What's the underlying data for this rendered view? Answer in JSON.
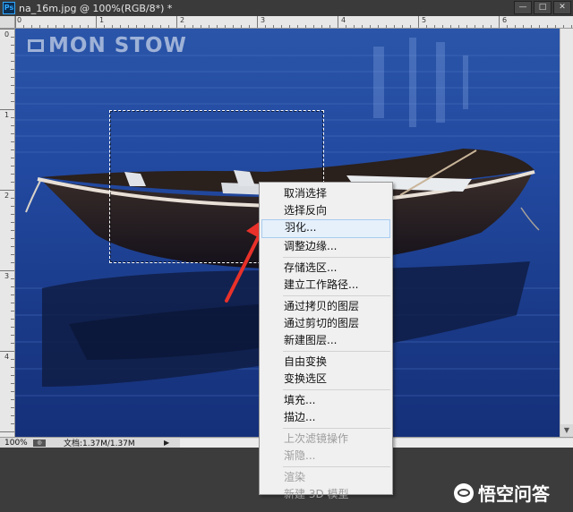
{
  "window": {
    "app_icon": "Ps",
    "title": "na_16m.jpg @ 100%(RGB/8*) *",
    "controls": {
      "minimize": "—",
      "maximize": "□",
      "close": "✕"
    }
  },
  "rulers": {
    "top": [
      "0",
      "1",
      "2",
      "3",
      "4",
      "5",
      "6"
    ],
    "left": [
      "0",
      "1",
      "2",
      "3",
      "4"
    ]
  },
  "canvas": {
    "watermark": "MON STOW"
  },
  "status": {
    "zoom": "100%",
    "doc_info": "文档:1.37M/1.37M",
    "arrow": "▶"
  },
  "context_menu": {
    "items": [
      {
        "label": "取消选择",
        "state": "enabled"
      },
      {
        "label": "选择反向",
        "state": "enabled"
      },
      {
        "label": "羽化...",
        "state": "hover"
      },
      {
        "label": "调整边缘...",
        "state": "enabled"
      },
      {
        "separator": true
      },
      {
        "label": "存储选区...",
        "state": "enabled"
      },
      {
        "label": "建立工作路径...",
        "state": "enabled"
      },
      {
        "separator": true
      },
      {
        "label": "通过拷贝的图层",
        "state": "enabled"
      },
      {
        "label": "通过剪切的图层",
        "state": "enabled"
      },
      {
        "label": "新建图层...",
        "state": "enabled"
      },
      {
        "separator": true
      },
      {
        "label": "自由变换",
        "state": "enabled"
      },
      {
        "label": "变换选区",
        "state": "enabled"
      },
      {
        "separator": true
      },
      {
        "label": "填充...",
        "state": "enabled"
      },
      {
        "label": "描边...",
        "state": "enabled"
      },
      {
        "separator": true
      },
      {
        "label": "上次滤镜操作",
        "state": "disabled"
      },
      {
        "label": "渐隐...",
        "state": "disabled"
      },
      {
        "separator": true
      },
      {
        "label": "渲染",
        "state": "disabled"
      },
      {
        "label": "新建 3D 模型",
        "state": "disabled"
      }
    ]
  },
  "annotation": {
    "arrow_color": "#e8312a"
  },
  "brand": {
    "text": "悟空问答"
  }
}
